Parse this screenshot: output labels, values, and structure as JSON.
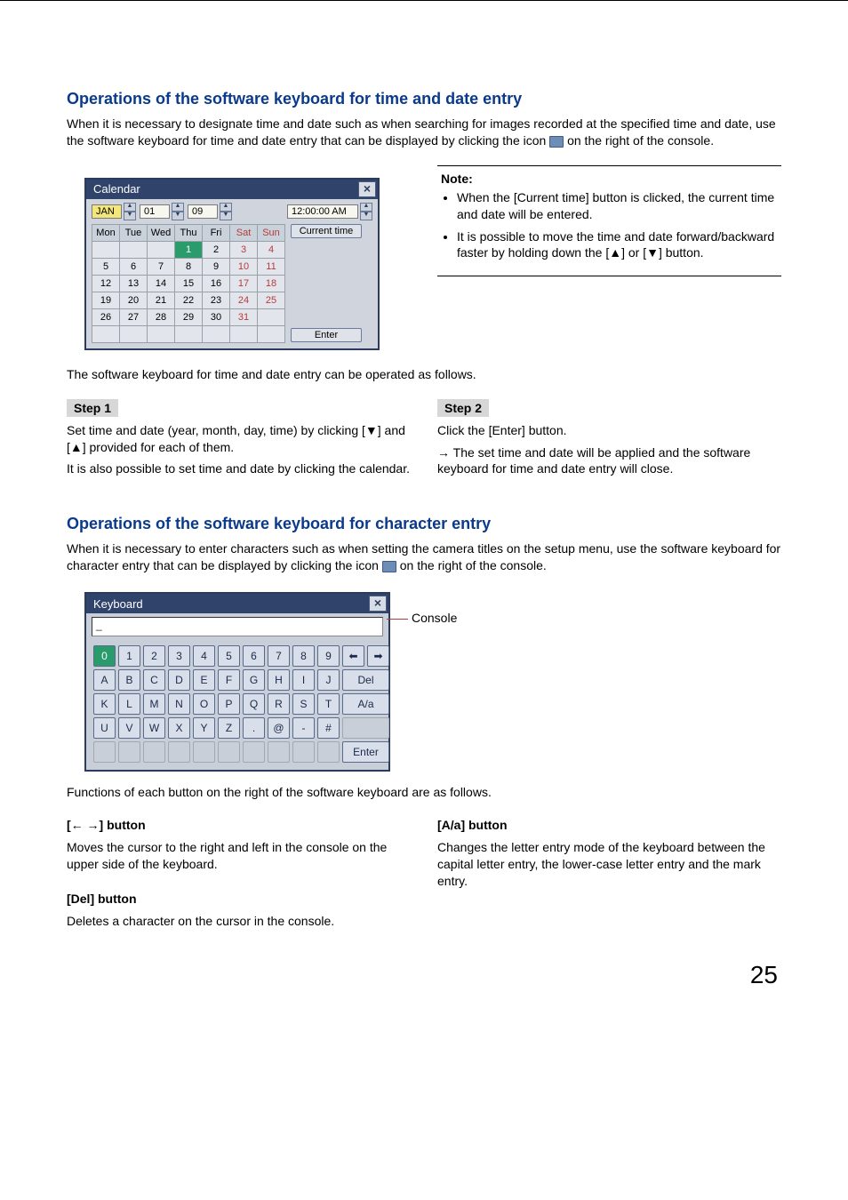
{
  "section1": {
    "heading": "Operations of the software keyboard for time and date entry",
    "intro": "When it is necessary to designate time and date such as when searching for images recorded at the specified time and date, use the software keyboard for time and date entry that can be displayed by clicking the icon ",
    "intro_tail": " on the right of the console.",
    "below_cal": "The software keyboard for time and date entry can be operated as follows."
  },
  "calendar": {
    "title": "Calendar",
    "month": "JAN",
    "day": "01",
    "year": "09",
    "time": "12:00:00 AM",
    "headers": [
      "Mon",
      "Tue",
      "Wed",
      "Thu",
      "Fri",
      "Sat",
      "Sun"
    ],
    "rows": [
      [
        "",
        "",
        "",
        "1",
        "2",
        "3",
        "4"
      ],
      [
        "5",
        "6",
        "7",
        "8",
        "9",
        "10",
        "11"
      ],
      [
        "12",
        "13",
        "14",
        "15",
        "16",
        "17",
        "18"
      ],
      [
        "19",
        "20",
        "21",
        "22",
        "23",
        "24",
        "25"
      ],
      [
        "26",
        "27",
        "28",
        "29",
        "30",
        "31",
        ""
      ],
      [
        "",
        "",
        "",
        "",
        "",
        "",
        ""
      ]
    ],
    "selected": "1",
    "current_time_btn": "Current time",
    "enter_btn": "Enter"
  },
  "note": {
    "title": "Note:",
    "items": [
      "When the [Current time] button is clicked, the current time and date will be entered.",
      "It is possible to move the time and date forward/backward faster by holding down the [▲] or [▼] button."
    ]
  },
  "steps": {
    "s1_label": "Step 1",
    "s1_p1": "Set time and date (year, month, day, time) by clicking [▼] and [▲] provided for each of them.",
    "s1_p2": "It is also possible to set time and date by clicking the calendar.",
    "s2_label": "Step 2",
    "s2_p1": "Click the [Enter] button.",
    "s2_p2": "The set time and date will be applied and the software keyboard for time and date entry will close."
  },
  "section2": {
    "heading": "Operations of the software keyboard for character entry",
    "intro_a": "When it is necessary to enter characters such as when setting the camera titles on the setup menu, use the software keyboard for character entry that can be displayed by clicking the icon ",
    "intro_b": " on the right of the console.",
    "below_kb": "Functions of each button on the right of the software keyboard are as follows."
  },
  "keyboard": {
    "title": "Keyboard",
    "console_text": "_",
    "console_label": "Console",
    "rows": [
      [
        "0",
        "1",
        "2",
        "3",
        "4",
        "5",
        "6",
        "7",
        "8",
        "9",
        "⬅",
        "➡"
      ],
      [
        "A",
        "B",
        "C",
        "D",
        "E",
        "F",
        "G",
        "H",
        "I",
        "J",
        "Del"
      ],
      [
        "K",
        "L",
        "M",
        "N",
        "O",
        "P",
        "Q",
        "R",
        "S",
        "T",
        "A/a"
      ],
      [
        "U",
        "V",
        "W",
        "X",
        "Y",
        "Z",
        ".",
        "@",
        "-",
        "#",
        ""
      ],
      [
        "",
        "",
        "",
        "",
        "",
        "",
        "",
        "",
        "",
        "",
        "Enter"
      ]
    ],
    "selected_key": "0"
  },
  "buttons_desc": {
    "arrow_title": "[← →] button",
    "arrow_body": "Moves the cursor to the right and left in the console on the upper side of the keyboard.",
    "del_title": "[Del] button",
    "del_body": "Deletes a character on the cursor in the console.",
    "aa_title": "[A/a] button",
    "aa_body": "Changes the letter entry mode of the keyboard between the capital letter entry, the lower-case letter entry and the mark entry."
  },
  "page_number": "25"
}
